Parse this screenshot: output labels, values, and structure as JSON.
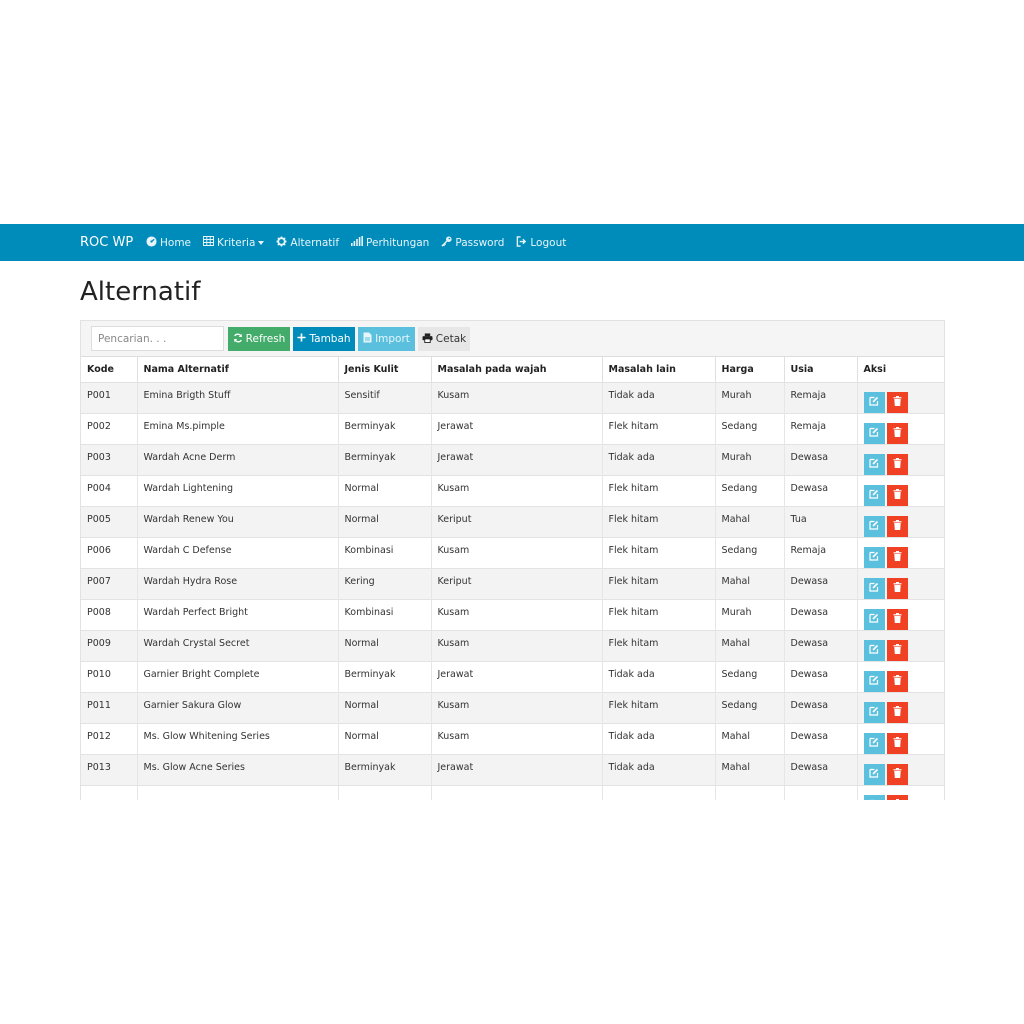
{
  "navbar": {
    "brand": "ROC WP",
    "items": [
      {
        "label": "Home",
        "icon": "dashboard-icon"
      },
      {
        "label": "Kriteria",
        "icon": "table-icon",
        "dropdown": true
      },
      {
        "label": "Alternatif",
        "icon": "gear-icon"
      },
      {
        "label": "Perhitungan",
        "icon": "signal-icon"
      },
      {
        "label": "Password",
        "icon": "key-icon"
      },
      {
        "label": "Logout",
        "icon": "logout-icon"
      }
    ]
  },
  "page": {
    "title": "Alternatif"
  },
  "toolbar": {
    "search_placeholder": "Pencarian. . .",
    "refresh_label": "Refresh",
    "tambah_label": "Tambah",
    "import_label": "Import",
    "cetak_label": "Cetak"
  },
  "table": {
    "columns": [
      "Kode",
      "Nama Alternatif",
      "Jenis Kulit",
      "Masalah pada wajah",
      "Masalah lain",
      "Harga",
      "Usia",
      "Aksi"
    ],
    "rows": [
      [
        "P001",
        "Emina Brigth Stuff",
        "Sensitif",
        "Kusam",
        "Tidak ada",
        "Murah",
        "Remaja"
      ],
      [
        "P002",
        "Emina Ms.pimple",
        "Berminyak",
        "Jerawat",
        "Flek hitam",
        "Sedang",
        "Remaja"
      ],
      [
        "P003",
        "Wardah Acne Derm",
        "Berminyak",
        "Jerawat",
        "Tidak ada",
        "Murah",
        "Dewasa"
      ],
      [
        "P004",
        "Wardah Lightening",
        "Normal",
        "Kusam",
        "Flek hitam",
        "Sedang",
        "Dewasa"
      ],
      [
        "P005",
        "Wardah Renew You",
        "Normal",
        "Keriput",
        "Flek hitam",
        "Mahal",
        "Tua"
      ],
      [
        "P006",
        "Wardah C Defense",
        "Kombinasi",
        "Kusam",
        "Flek hitam",
        "Sedang",
        "Remaja"
      ],
      [
        "P007",
        "Wardah Hydra Rose",
        "Kering",
        "Keriput",
        "Flek hitam",
        "Mahal",
        "Dewasa"
      ],
      [
        "P008",
        "Wardah Perfect Bright",
        "Kombinasi",
        "Kusam",
        "Flek hitam",
        "Murah",
        "Dewasa"
      ],
      [
        "P009",
        "Wardah Crystal Secret",
        "Normal",
        "Kusam",
        "Flek hitam",
        "Mahal",
        "Dewasa"
      ],
      [
        "P010",
        "Garnier Bright Complete",
        "Berminyak",
        "Jerawat",
        "Tidak ada",
        "Sedang",
        "Dewasa"
      ],
      [
        "P011",
        "Garnier Sakura Glow",
        "Normal",
        "Kusam",
        "Flek hitam",
        "Sedang",
        "Dewasa"
      ],
      [
        "P012",
        "Ms. Glow Whitening Series",
        "Normal",
        "Kusam",
        "Tidak ada",
        "Mahal",
        "Dewasa"
      ],
      [
        "P013",
        "Ms. Glow Acne Series",
        "Berminyak",
        "Jerawat",
        "Tidak ada",
        "Mahal",
        "Dewasa"
      ],
      [
        "",
        "",
        "",
        "",
        "",
        "",
        ""
      ]
    ]
  },
  "colors": {
    "navbar": "#008cba",
    "refresh": "#43ac6a",
    "tambah": "#008cba",
    "import": "#5bc0de",
    "edit": "#5bc0de",
    "delete": "#f04124"
  }
}
